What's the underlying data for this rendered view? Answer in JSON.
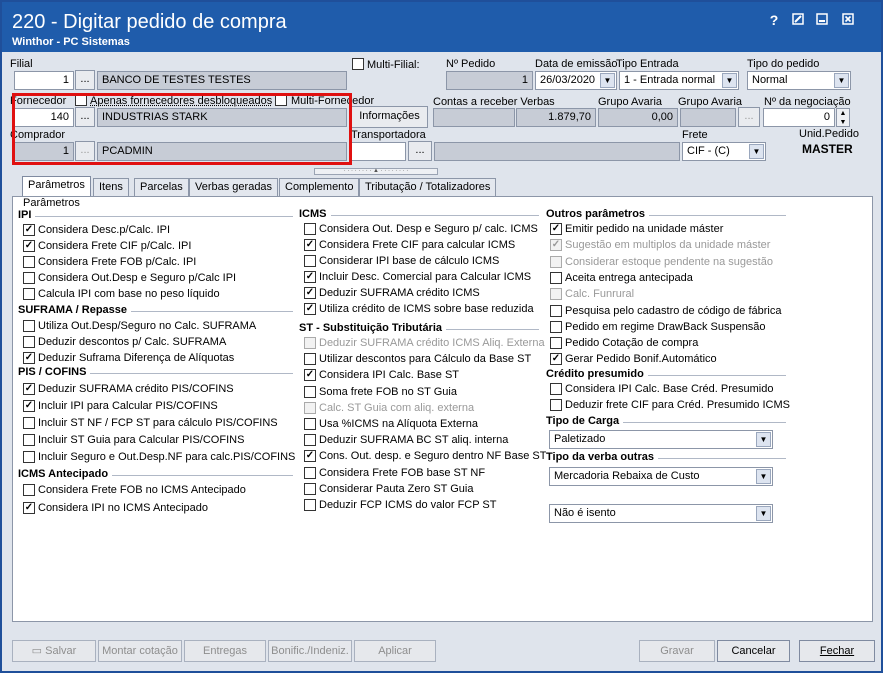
{
  "window": {
    "title": "220 - Digitar pedido de compra",
    "subtitle": "Winthor - PC Sistemas"
  },
  "titlebar_icons": [
    "help-icon",
    "edit-icon",
    "minimize-icon",
    "close-icon"
  ],
  "header": {
    "filial_label": "Filial",
    "filial_code": "1",
    "filial_name": "BANCO DE TESTES TESTES",
    "multifilial_label": "Multi-Filial:",
    "npedido_label": "Nº Pedido",
    "npedido_value": "1",
    "data_emissao_label": "Data de emissão",
    "data_emissao_value": "26/03/2020",
    "tipo_entrada_label": "Tipo Entrada",
    "tipo_entrada_value": "1 - Entrada normal",
    "tipo_pedido_label": "Tipo do pedido",
    "tipo_pedido_value": "Normal",
    "fornecedor_label": "Fornecedor",
    "apenas_label": "Apenas fornecedores desbloqueados",
    "multifornecedor_label": "Multi-Fornecedor",
    "fornecedor_code": "140",
    "fornecedor_name": "INDUSTRIAS STARK",
    "informacoes_label": "Informações",
    "contas_label": "Contas a receber Verbas",
    "contas_value": "1.879,70",
    "grupo_avaria1_label": "Grupo Avaria",
    "grupo_avaria1_value": "0,00",
    "grupo_avaria2_label": "Grupo Avaria",
    "negociacao_label": "Nº da negociação",
    "negociacao_value": "0",
    "comprador_label": "Comprador",
    "comprador_code": "1",
    "comprador_name": "PCADMIN",
    "transportadora_label": "Transportadora",
    "frete_label": "Frete",
    "frete_value": "CIF - (C)",
    "unid_label": "Unid.Pedido",
    "unid_value": "MASTER",
    "dots": "..."
  },
  "tabs": [
    "Parâmetros",
    "Itens",
    "Parcelas",
    "Verbas geradas",
    "Complemento",
    "Tributação / Totalizadores"
  ],
  "panel_title": "Parâmetros",
  "col1": {
    "ipi_title": "IPI",
    "ipi": [
      {
        "label": "Considera Desc.p/Calc. IPI",
        "checked": true
      },
      {
        "label": "Considera Frete CIF p/Calc. IPI",
        "checked": true
      },
      {
        "label": "Considera Frete FOB p/Calc. IPI",
        "checked": false
      },
      {
        "label": "Considera Out.Desp e Seguro p/Calc IPI",
        "checked": false
      },
      {
        "label": "Calcula IPI com base no peso líquido",
        "checked": false
      }
    ],
    "suframa_title": "SUFRAMA / Repasse",
    "suframa": [
      {
        "label": "Utiliza Out.Desp/Seguro no Calc. SUFRAMA",
        "checked": false
      },
      {
        "label": "Deduzir descontos p/ Calc. SUFRAMA",
        "checked": false
      },
      {
        "label": "Deduzir Suframa Diferença de Alíquotas",
        "checked": true
      }
    ],
    "pis_title": "PIS / COFINS",
    "pis": [
      {
        "label": "Deduzir SUFRAMA crédito PIS/COFINS",
        "checked": true
      },
      {
        "label": "Incluir IPI para Calcular PIS/COFINS",
        "checked": true
      },
      {
        "label": "Incluir ST NF / FCP ST para cálculo PIS/COFINS",
        "checked": false
      },
      {
        "label": "Incluir ST Guia para Calcular PIS/COFINS",
        "checked": false
      },
      {
        "label": "Incluir Seguro e Out.Desp.NF para calc.PIS/COFINS",
        "checked": false
      }
    ],
    "icmsant_title": "ICMS Antecipado",
    "icmsant": [
      {
        "label": "Considera Frete FOB no ICMS Antecipado",
        "checked": false
      },
      {
        "label": "Considera IPI no ICMS Antecipado",
        "checked": true
      }
    ]
  },
  "col2": {
    "icms_title": "ICMS",
    "icms": [
      {
        "label": "Considera Out. Desp e Seguro p/ calc. ICMS",
        "checked": false
      },
      {
        "label": "Considera Frete CIF para calcular ICMS",
        "checked": true
      },
      {
        "label": "Considerar IPI base de cálculo ICMS",
        "checked": false
      },
      {
        "label": "Incluir Desc. Comercial  para Calcular ICMS",
        "checked": true
      },
      {
        "label": "Deduzir SUFRAMA crédito ICMS",
        "checked": true
      },
      {
        "label": "Utiliza crédito de ICMS sobre base reduzida",
        "checked": true
      }
    ],
    "st_title": "ST - Substituição Tributária",
    "st": [
      {
        "label": "Deduzir SUFRAMA crédito ICMS Aliq. Externa",
        "checked": false,
        "disabled": true
      },
      {
        "label": "Utilizar descontos para Cálculo da Base ST",
        "checked": false
      },
      {
        "label": "Considera IPI Calc. Base ST",
        "checked": true
      },
      {
        "label": "Soma frete FOB no ST Guia",
        "checked": false
      },
      {
        "label": "Calc. ST Guia com aliq. externa",
        "checked": false,
        "disabled": true
      },
      {
        "label": "Usa %ICMS na Alíquota Externa",
        "checked": false
      },
      {
        "label": "Deduzir SUFRAMA BC ST aliq. interna",
        "checked": false
      },
      {
        "label": "Cons. Out. desp. e Seguro dentro NF Base ST",
        "checked": true
      },
      {
        "label": "Considera Frete FOB base ST NF",
        "checked": false
      },
      {
        "label": "Considerar Pauta Zero ST Guia",
        "checked": false
      },
      {
        "label": "Deduzir FCP ICMS do valor FCP ST",
        "checked": false
      }
    ]
  },
  "col3": {
    "outros_title": "Outros parâmetros",
    "outros": [
      {
        "label": "Emitir pedido na unidade máster",
        "checked": true
      },
      {
        "label": "Sugestão em multiplos da unidade máster",
        "checked": true,
        "disabled": true
      },
      {
        "label": "Considerar estoque pendente na sugestão",
        "checked": false,
        "disabled": true
      },
      {
        "label": "Aceita entrega antecipada",
        "checked": false
      },
      {
        "label": "Calc. Funrural",
        "checked": false,
        "disabled": true
      },
      {
        "label": "Pesquisa pelo cadastro de código de fábrica",
        "checked": false
      },
      {
        "label": "Pedido em regime DrawBack Suspensão",
        "checked": false
      },
      {
        "label": "Pedido Cotação de compra",
        "checked": false
      },
      {
        "label": "Gerar Pedido Bonif.Automático",
        "checked": true
      }
    ],
    "credito_title": "Crédito presumido",
    "credito": [
      {
        "label": "Considera IPI Calc. Base Créd. Presumido",
        "checked": false
      },
      {
        "label": "Deduzir frete CIF para Créd. Presumido ICMS",
        "checked": false
      }
    ],
    "carga_title": "Tipo de Carga",
    "carga_value": "Paletizado",
    "verba_title": "Tipo da verba outras",
    "verba_value": "Mercadoria Rebaixa de Custo",
    "isento_value": "Não é isento"
  },
  "buttons": {
    "salvar": "Salvar",
    "montar": "Montar cotação",
    "entregas": "Entregas",
    "bonific": "Bonific./Indeniz.",
    "aplicar": "Aplicar",
    "gravar": "Gravar",
    "cancelar": "Cancelar",
    "fechar": "Fechar"
  }
}
